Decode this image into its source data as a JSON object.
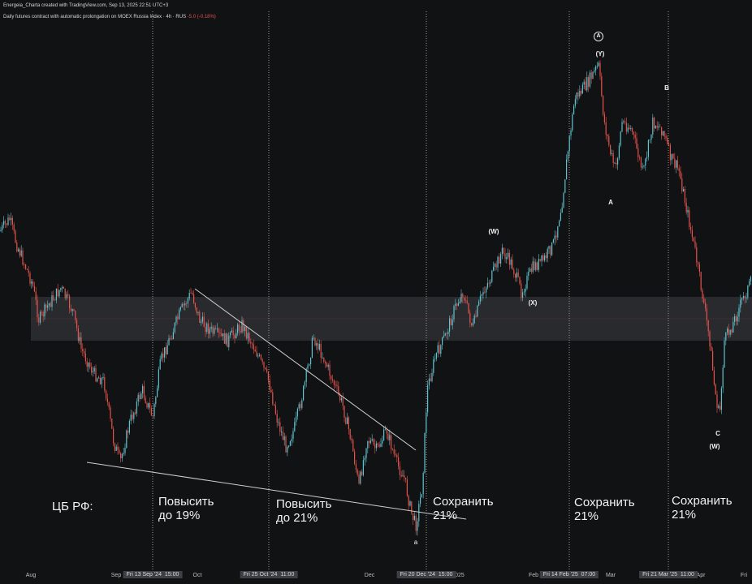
{
  "header": {
    "credit": "Energeia_Charta created with TradingView.com, Sep 13, 2025 22:51 UTC+3",
    "symbol_line": "Daily futures contract with automatic prolongation on MOEX Russia Index · 4h · RUS",
    "change": "-5.0 (-0.18%)"
  },
  "x_axis": {
    "ticks": [
      {
        "id": "aug",
        "label": "Aug"
      },
      {
        "id": "sep",
        "label": "Sep"
      },
      {
        "id": "oct",
        "label": "Oct"
      },
      {
        "id": "dec",
        "label": "Dec"
      },
      {
        "id": "y2025",
        "label": "2025"
      },
      {
        "id": "feb",
        "label": "Feb"
      },
      {
        "id": "mar",
        "label": "Mar"
      },
      {
        "id": "apr",
        "label": "Apr"
      },
      {
        "id": "fri",
        "label": "Fri"
      }
    ],
    "event_labels": [
      {
        "id": "e1",
        "label": "Fri 13 Sep '24",
        "time": "15:00"
      },
      {
        "id": "e2",
        "label": "Fri 25 Oct '24",
        "time": "11:00"
      },
      {
        "id": "e3",
        "label": "Fri 20 Dec '24",
        "time": "15:00"
      },
      {
        "id": "e4",
        "label": "Fri 14 Feb '25",
        "time": "07:00"
      },
      {
        "id": "e5",
        "label": "Fri 21 Mar '25",
        "time": "11:00"
      }
    ]
  },
  "annotations": {
    "cb": "ЦБ РФ:",
    "notes": [
      {
        "id": "n1",
        "line1": "Повысить",
        "line2": "до 19%"
      },
      {
        "id": "n2",
        "line1": "Повысить",
        "line2": "до 21%"
      },
      {
        "id": "n3",
        "line1": "Сохранить",
        "line2": "21%"
      },
      {
        "id": "n4",
        "line1": "Сохранить",
        "line2": "21%"
      },
      {
        "id": "n5",
        "line1": "Сохранить",
        "line2": "21%"
      }
    ],
    "waves": [
      {
        "id": "w1",
        "label": "(W)"
      },
      {
        "id": "x1",
        "label": "(X)"
      },
      {
        "id": "y1",
        "label": "(Y)"
      },
      {
        "id": "A",
        "label": "A"
      },
      {
        "id": "B",
        "label": "B"
      },
      {
        "id": "C",
        "label": "C"
      },
      {
        "id": "w2",
        "label": "(W)"
      },
      {
        "id": "a",
        "label": "a"
      },
      {
        "id": "circA",
        "label": "A"
      }
    ]
  },
  "colors": {
    "background": "#111214",
    "up_candle": "#5fc3cf",
    "down_candle": "#e5534b",
    "zone": "#2e2f33",
    "guide": "#bdbdbd"
  }
}
